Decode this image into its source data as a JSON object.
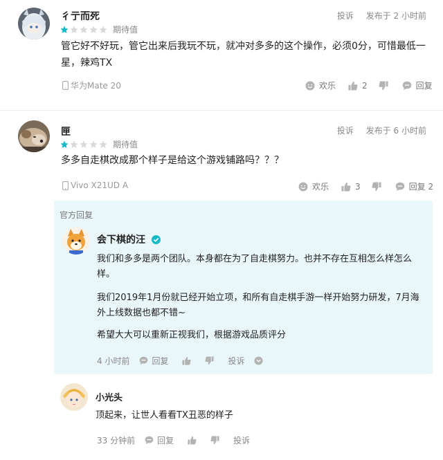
{
  "reviews": [
    {
      "username": "彳亍而死",
      "rating": 1,
      "rating_label": "期待值",
      "report": "投诉",
      "time": "发布于 2 小时前",
      "body": "管它好不好玩，管它出来后我玩不玩，就冲对多多的这个操作，必须0分，可惜最低一星，辣鸡TX",
      "device": "华为Mate 20",
      "happy_label": "欢乐",
      "likes": "2",
      "reply_label": "回复"
    },
    {
      "username": "匣",
      "rating": 1,
      "rating_label": "期待值",
      "report": "投诉",
      "time": "发布于 6 小时前",
      "body": "多多自走棋改成那个样子是给这个游戏铺路吗？？？",
      "device": "Vivo X21UD A",
      "happy_label": "欢乐",
      "likes": "3",
      "reply_label": "回复 2"
    }
  ],
  "official_reply": {
    "title": "官方回复",
    "name": "会下棋的汪",
    "paragraphs": [
      "我们和多多是两个团队。本身都在为了自走棋努力。也并不存在互相怎么样怎么样。",
      "我们2019年1月份就已经开始立项，和所有自走棋手游一样开始努力研发，7月海外上线数据也都不错~",
      "希望大大可以重新正视我们，根据游戏品质评分"
    ],
    "time": "4 小时前",
    "reply_label": "回复",
    "report": "投诉"
  },
  "sub_reply": {
    "name": "小光头",
    "body": "顶起来，让世人看看TX丑恶的样子",
    "time": "33 分钟前",
    "reply_label": "回复",
    "report": "投诉"
  },
  "colors": {
    "star_on": "#14b9c8",
    "star_off": "#d9d9d9",
    "official_bg": "#eaf7fa",
    "verified": "#14b9c8"
  }
}
